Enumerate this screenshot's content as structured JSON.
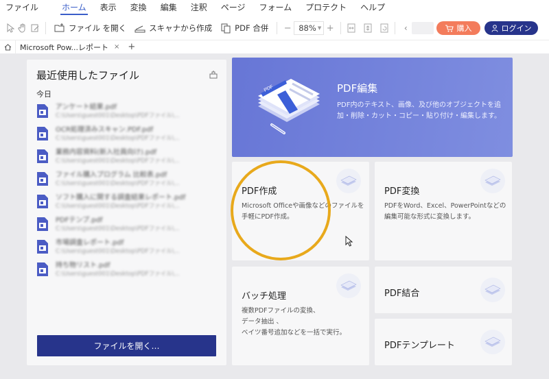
{
  "menu": [
    "ファイル",
    "ホーム",
    "表示",
    "変換",
    "編集",
    "注釈",
    "ページ",
    "フォーム",
    "プロテクト",
    "ヘルプ"
  ],
  "toolbar": {
    "open_file": "ファイル を開く",
    "scanner": "スキャナから作成",
    "combine": "PDF 合併",
    "zoom_value": "88%",
    "page_prev": "‹",
    "page_next": "›",
    "buy_label": "購入",
    "login_label": "ログイン"
  },
  "tabs": {
    "doc_tab": "Microsoft Pow...レポート",
    "close": "×",
    "new": "+"
  },
  "recent": {
    "title": "最近使用したファイル",
    "section_today": "今日",
    "open_button": "ファイルを開く…",
    "files": [
      {
        "name": "アンケート結果.pdf",
        "path": "C:\\Users\\guest001\\Desktop\\PDFファイル\\..."
      },
      {
        "name": "OCR処理済みスキャン.PDF.pdf",
        "path": "C:\\Users\\guest001\\Desktop\\PDFファイル\\..."
      },
      {
        "name": "業務内容資料(新入社員向け).pdf",
        "path": "C:\\Users\\guest001\\Desktop\\PDFファイル\\..."
      },
      {
        "name": "ファイル購入プログラム 比較表.pdf",
        "path": "C:\\Users\\guest001\\Desktop\\PDFファイル\\..."
      },
      {
        "name": "ソフト購入に関する調査結果レポート.pdf",
        "path": "C:\\Users\\guest001\\Desktop\\PDFファイル\\..."
      },
      {
        "name": "PDFテンプ.pdf",
        "path": "C:\\Users\\guest001\\Desktop\\PDFファイル\\..."
      },
      {
        "name": "市場調査レポート.pdf",
        "path": "C:\\Users\\guest001\\Desktop\\PDFファイル\\..."
      },
      {
        "name": "持ち物リスト.pdf",
        "path": "C:\\Users\\guest001\\Desktop\\PDFファイル\\..."
      }
    ]
  },
  "cards": {
    "edit": {
      "title": "PDF編集",
      "desc": "PDF内のテキスト、画像、及び他のオブジェクトを追加・削除・カット・コピー・貼り付け・編集します。"
    },
    "create": {
      "title": "PDF作成",
      "desc": "Microsoft Officeや画像などのファイルを手軽にPDF作成。"
    },
    "convert": {
      "title": "PDF変換",
      "desc": "PDFをWord、Excel、PowerPointなどの編集可能な形式に変換します。"
    },
    "batch": {
      "title": "バッチ処理",
      "desc_lines": [
        "複数PDFファイルの変換、",
        "データ抽出 、",
        "ベイツ番号追加などを一括で実行。"
      ]
    },
    "combine": {
      "title": "PDF結合"
    },
    "template": {
      "title": "PDFテンプレート"
    }
  },
  "colors": {
    "accent": "#3a5ec9",
    "primary_button": "#27348b",
    "buy_button": "#f37c5c",
    "edit_card": "#6f7dd9",
    "highlight": "#e8a91c"
  }
}
